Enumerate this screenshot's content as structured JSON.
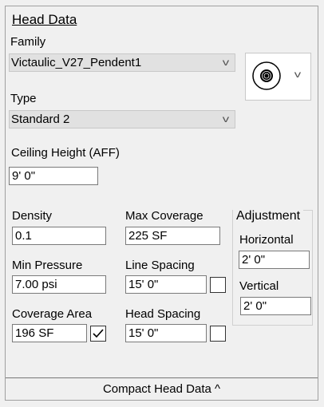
{
  "panel": {
    "title": "Head Data"
  },
  "family": {
    "label": "Family",
    "value": "Victaulic_V27_Pendent1",
    "icon": "sprinkler-head-preview-icon"
  },
  "type": {
    "label": "Type",
    "value": "Standard 2"
  },
  "ceiling_height": {
    "label": "Ceiling Height (AFF)",
    "value": "9'  0\""
  },
  "density": {
    "label": "Density",
    "value": "0.1"
  },
  "max_coverage": {
    "label": "Max Coverage",
    "value": "225 SF"
  },
  "min_pressure": {
    "label": "Min Pressure",
    "value": "7.00 psi"
  },
  "line_spacing": {
    "label": "Line Spacing",
    "value": "15'  0\"",
    "checked": false
  },
  "coverage_area": {
    "label": "Coverage Area",
    "value": "196 SF",
    "checked": true
  },
  "head_spacing": {
    "label": "Head Spacing",
    "value": "15'  0\"",
    "checked": false
  },
  "adjustment": {
    "title": "Adjustment",
    "horizontal_label": "Horizontal",
    "horizontal_value": "2'  0\"",
    "vertical_label": "Vertical",
    "vertical_value": "2'  0\""
  },
  "footer": {
    "label": "Compact Head Data ^"
  }
}
